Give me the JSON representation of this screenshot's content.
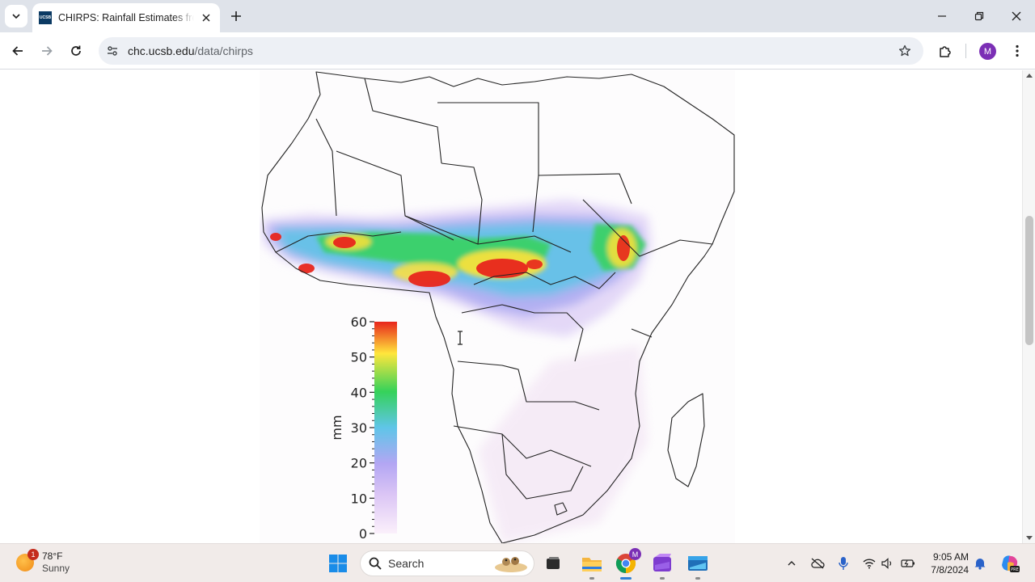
{
  "browser": {
    "tab_title": "CHIRPS: Rainfall Estimates from Rain Gauge and Satellite Observations",
    "favicon_text": "UCSB",
    "url_domain": "chc.ucsb.edu",
    "url_path": "/data/chirps",
    "profile_initial": "M"
  },
  "figure": {
    "colorbar_label": "mm",
    "colorbar_ticks": [
      "60",
      "50",
      "40",
      "30",
      "20",
      "10",
      "0"
    ],
    "colorbar_range": [
      0,
      60
    ],
    "colors": {
      "max": "#e8251c",
      "mid_high": "#ffe63c",
      "mid": "#33d35a",
      "mid_low": "#63c6e6",
      "low": "#b8a4f2",
      "min": "#f6e8f6"
    }
  },
  "taskbar": {
    "weather_temp": "78°F",
    "weather_condition": "Sunny",
    "weather_badge": "1",
    "search_label": "Search",
    "chrome_badge": "M",
    "time": "9:05 AM",
    "date": "7/8/2024"
  }
}
